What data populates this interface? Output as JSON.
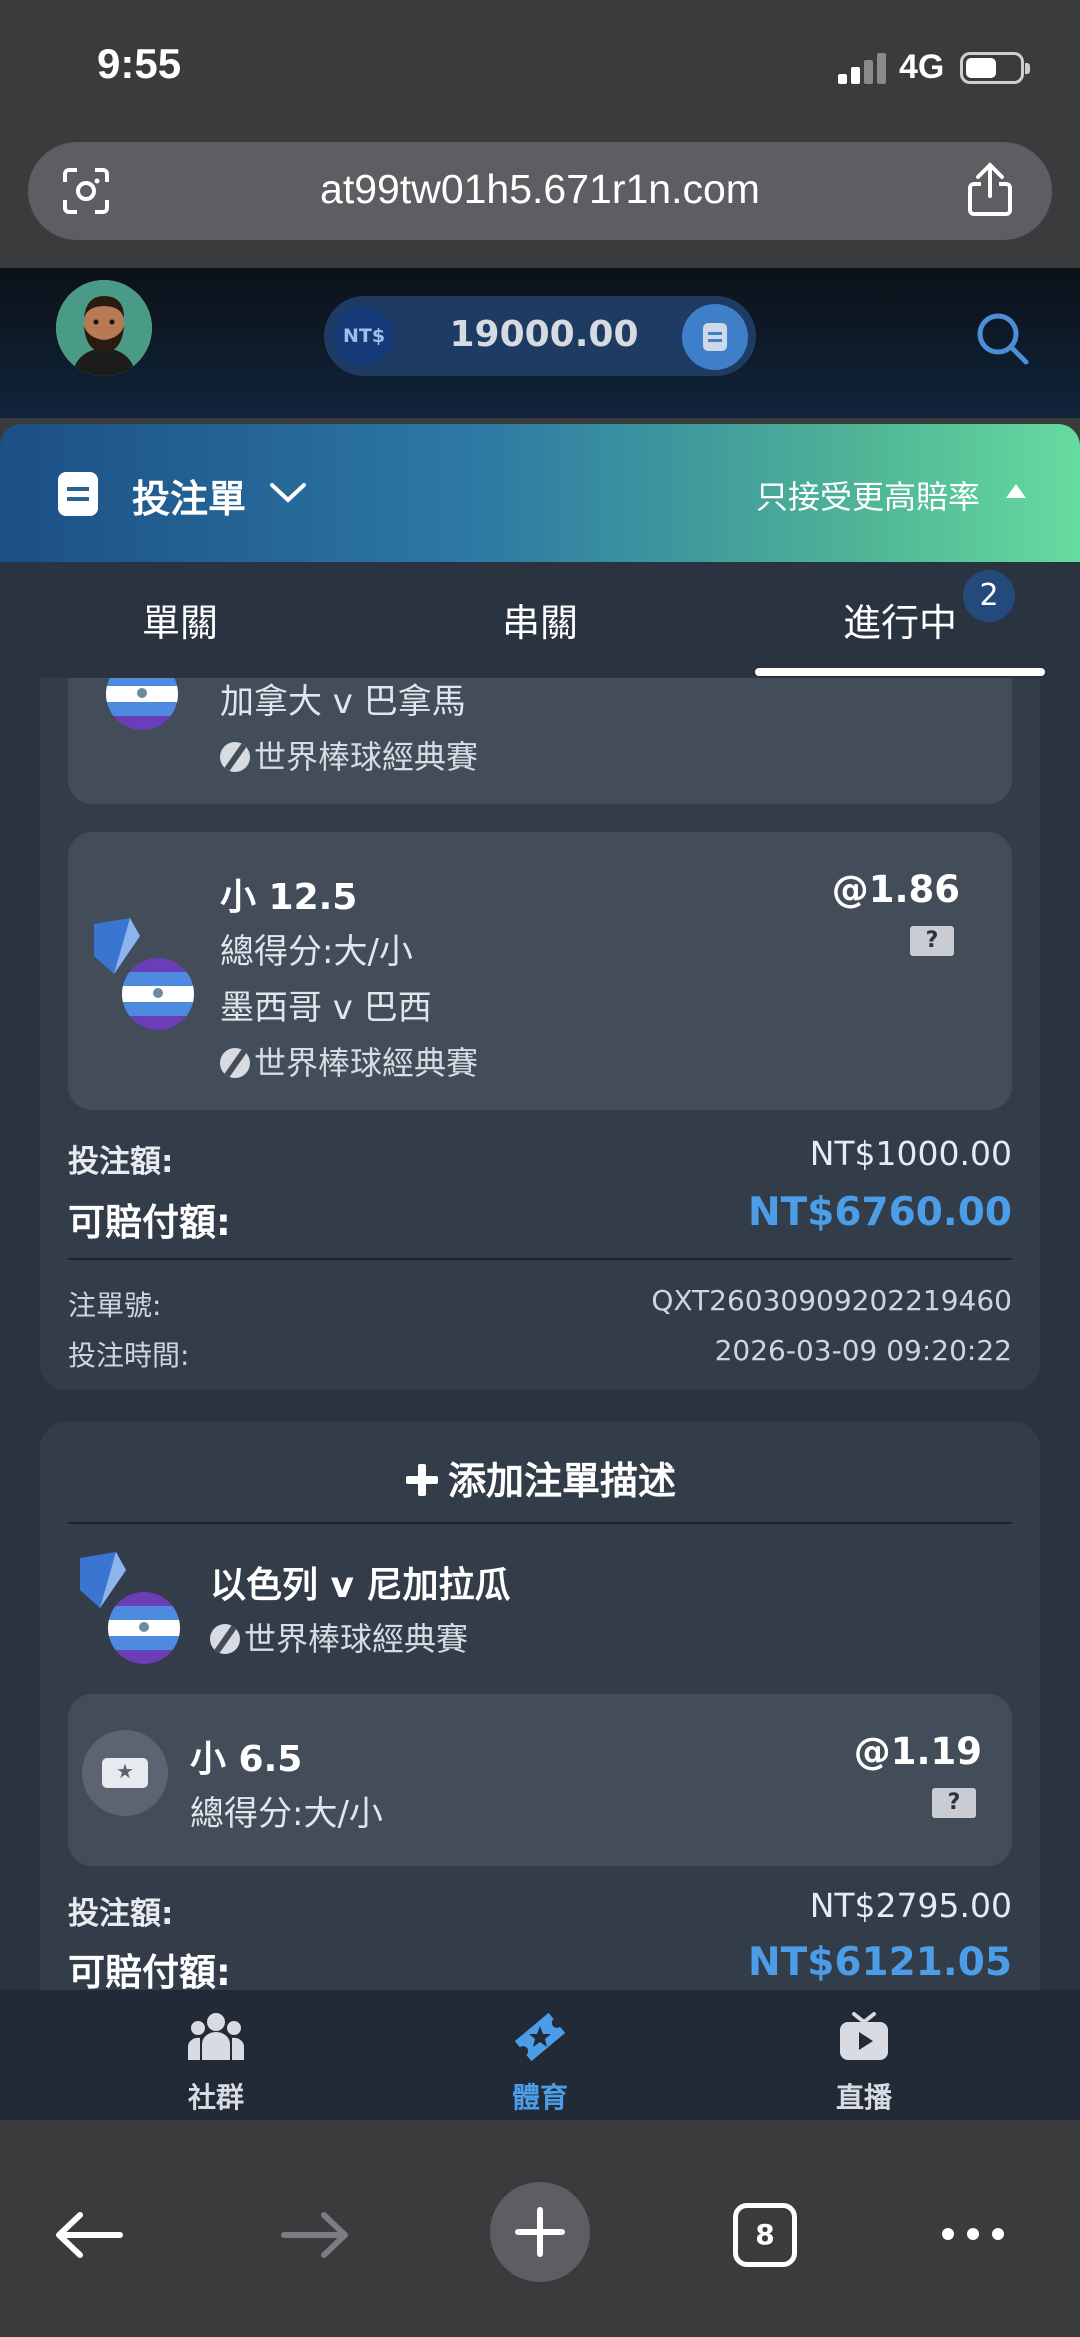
{
  "status_bar": {
    "time": "9:55",
    "network": "4G"
  },
  "browser": {
    "url": "at99tw01h5.671r1n.com",
    "tab_count": "8"
  },
  "header": {
    "currency": "NT$",
    "balance": "19000.00"
  },
  "bet_slip": {
    "title": "投注單",
    "odds_option": "只接受更高賠率",
    "tabs": [
      {
        "label": "單關"
      },
      {
        "label": "串關"
      },
      {
        "label": "進行中"
      }
    ],
    "active_badge": "2"
  },
  "bet1": {
    "partial_selection": {
      "match": "加拿大 v 巴拿馬",
      "league": "世界棒球經典賽"
    },
    "selection": {
      "pick": "小 12.5",
      "market": "總得分:大/小",
      "match": "墨西哥 v 巴西",
      "league": "世界棒球經典賽",
      "odds": "@1.86",
      "help": "?"
    },
    "stake_label": "投注額:",
    "stake_value": "NT$1000.00",
    "payout_label": "可賠付額:",
    "payout_value": "NT$6760.00",
    "ticket_label": "注單號:",
    "ticket_value": "QXT26030909202219460",
    "time_label": "投注時間:",
    "time_value": "2026-03-09 09:20:22"
  },
  "bet2": {
    "add_desc": "添加注單描述",
    "match": "以色列 v 尼加拉瓜",
    "league": "世界棒球經典賽",
    "selection": {
      "pick": "小 6.5",
      "market": "總得分:大/小",
      "odds": "@1.19",
      "help": "?"
    },
    "stake_label": "投注額:",
    "stake_value": "NT$2795.00",
    "payout_label": "可賠付額:",
    "payout_value": "NT$6121.05"
  },
  "bottom_nav": [
    {
      "label": "社群",
      "icon": "community-icon"
    },
    {
      "label": "體育",
      "icon": "sports-ticket-icon"
    },
    {
      "label": "直播",
      "icon": "live-tv-icon"
    }
  ],
  "colors": {
    "accent": "#4c9de8",
    "card": "#333d4a",
    "selection": "#434d59"
  }
}
